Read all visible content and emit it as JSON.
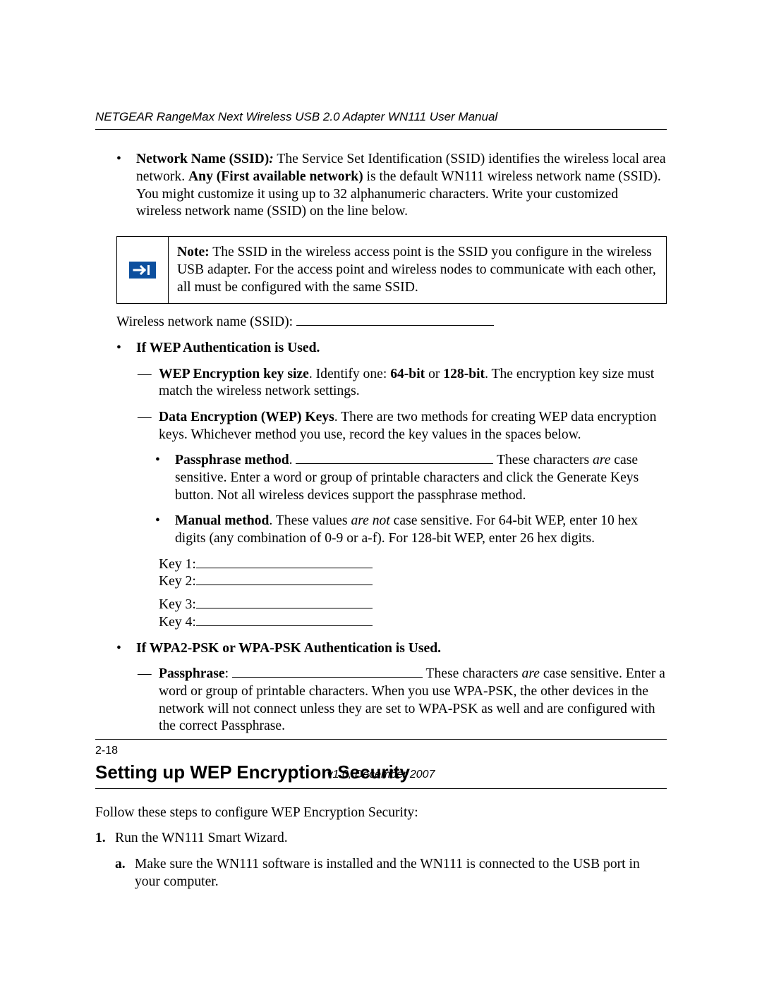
{
  "header": "NETGEAR RangeMax Next Wireless USB 2.0 Adapter WN111 User Manual",
  "ssid_item": {
    "label": "Network Name (SSID)",
    "colon": ":",
    "body1": " The Service Set Identification (SSID) identifies the wireless local area network. ",
    "bold_any": "Any (First available network)",
    "body2": " is the default WN111 wireless network name (SSID). You might customize it using up to 32 alphanumeric characters. Write your customized wireless network name (SSID) on the line below."
  },
  "note": {
    "label": "Note:",
    "text": " The SSID in the wireless access point is the SSID you configure in the wireless USB adapter. For the access point and wireless nodes to communicate with each other, all must be configured with the same SSID."
  },
  "ssid_line_label": "Wireless network name (SSID): ",
  "wep_heading": "If WEP Authentication is Used.",
  "wep_key_size": {
    "label": "WEP Encryption key size",
    "t1": ". Identify one: ",
    "b64": "64-bit",
    "t_or": " or ",
    "b128": "128-bit",
    "t2": ". The encryption key size must match the wireless network settings."
  },
  "wep_keys": {
    "label": "Data Encryption (WEP) Keys",
    "t": ". There are two methods for creating WEP data encryption keys. Whichever method you use, record the key values in the spaces below."
  },
  "passphrase_m": {
    "label": "Passphrase method",
    "dot": ". ",
    "t1": " These characters ",
    "i_are": "are",
    "t2": " case sensitive. Enter a word or group of printable characters and click the Generate Keys button. Not all wireless devices support the passphrase method."
  },
  "manual_m": {
    "label": "Manual method",
    "t1": ". These values ",
    "i_arenot": "are not",
    "t2": " case sensitive. For 64-bit WEP, enter 10 hex digits (any combination of 0-9 or a-f). For 128-bit WEP, enter 26 hex digits."
  },
  "keys": {
    "k1": "Key 1: ",
    "k2": " Key 2: ",
    "k3": "Key 3: ",
    "k4": " Key 4: "
  },
  "wpa_heading": "If WPA2-PSK or WPA-PSK Authentication is Used.",
  "wpa_pass": {
    "label": "Passphrase",
    "colon": ": ",
    "t1": " These characters ",
    "i_are": "are",
    "t2": " case sensitive. Enter a word or group of printable characters. When you use WPA-PSK, the other devices in the network will not connect unless they are set to WPA-PSK as well and are configured with the correct Passphrase."
  },
  "section_title": "Setting up WEP Encryption Security",
  "section_intro": "Follow these steps to configure WEP Encryption Security:",
  "step1": {
    "num": "1.",
    "text": "Run the WN111 Smart Wizard.",
    "a_mk": "a.",
    "a_text": "Make sure the WN111 software is installed and the WN111 is connected to the USB port in your computer."
  },
  "page_number": "2-18",
  "version": "v1.0, December 2007"
}
